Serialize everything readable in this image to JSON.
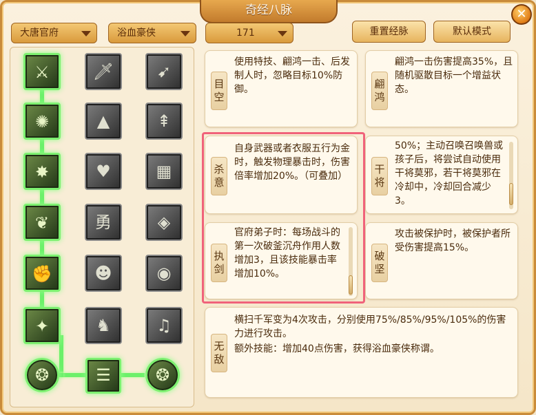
{
  "window": {
    "title": "奇经八脉",
    "close_icon": "close-icon"
  },
  "toolbar": {
    "sect": "大唐官府",
    "school": "浴血豪侠",
    "points": "171",
    "reset_label": "重置经脉",
    "default_label": "默认模式"
  },
  "tree": {
    "rows": [
      [
        {
          "icon": "sword-strike-icon",
          "active": true
        },
        {
          "icon": "swordsman-icon",
          "active": false
        },
        {
          "icon": "charge-icon",
          "active": false
        }
      ],
      [
        {
          "icon": "whirl-icon",
          "active": true
        },
        {
          "icon": "stone-icon",
          "active": false
        },
        {
          "icon": "spears-icon",
          "active": false
        }
      ],
      [
        {
          "icon": "burst-icon",
          "active": true
        },
        {
          "icon": "heart-hands-icon",
          "active": false
        },
        {
          "icon": "wall-icon",
          "active": false
        }
      ],
      [
        {
          "icon": "heart-emblem-icon",
          "active": true
        },
        {
          "icon": "brave-seal-icon",
          "active": false
        },
        {
          "icon": "shield-icon",
          "active": false
        }
      ],
      [
        {
          "icon": "blade-grip-icon",
          "active": true
        },
        {
          "icon": "thinker-icon",
          "active": false
        },
        {
          "icon": "eye-icon",
          "active": false
        }
      ],
      [
        {
          "icon": "shatter-icon",
          "active": true
        },
        {
          "icon": "warrior-icon",
          "active": false
        },
        {
          "icon": "horn-icon",
          "active": false
        }
      ]
    ],
    "bottom": [
      {
        "icon": "swirl-left-icon",
        "active": true
      },
      {
        "icon": "scroll-stack-icon",
        "active": true
      },
      {
        "icon": "swirl-right-icon",
        "active": true
      }
    ]
  },
  "cards": {
    "mukong": {
      "label": "目空",
      "desc": "使用特技、翩鸿一击、后发制人时，忽略目标10%防御。"
    },
    "pianhong": {
      "label": "翩鸿",
      "desc": "翩鸿一击伤害提高35%，且随机驱散目标一个增益状态。"
    },
    "shayi": {
      "label": "杀意",
      "desc": "自身武器或者衣服五行为金时，触发物理暴击时，伤害倍率增加20%。（可叠加）"
    },
    "ganjiang": {
      "label": "干将",
      "desc": "50%；主动召唤召唤兽或孩子后，将尝试自动使用干将莫邪，若干将莫邪在冷却中，冷却回合减少3。"
    },
    "zhijian": {
      "label": "执剑",
      "desc": "官府弟子时：每场战斗的第一次破釜沉舟作用人数增加3，且该技能暴击率增加10%。"
    },
    "pojian": {
      "label": "破坚",
      "desc": "攻击被保护时，被保护者所受伤害提高15%。"
    },
    "wudi": {
      "label": "无敌",
      "desc_line1": "横扫千军变为4次攻击，分别使用75%/85%/95%/105%的伤害力进行攻击。",
      "desc_line2": "额外技能：增加40点伤害，获得浴血豪侠称谓。"
    }
  },
  "colors": {
    "accent": "#c98b3a",
    "active_glow": "#7df070",
    "highlight": "#f0627a"
  }
}
